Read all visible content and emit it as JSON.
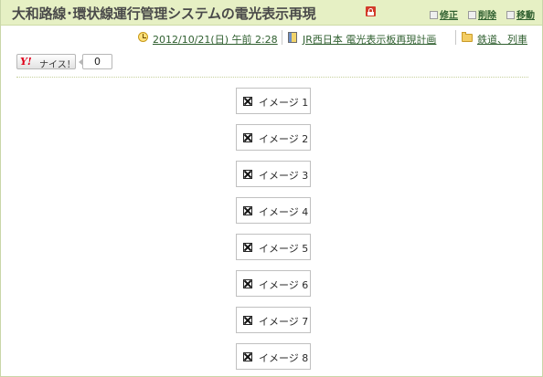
{
  "title": "大和路線･環状線運行管理システムの電光表示再現",
  "actions": {
    "edit": "修正",
    "delete": "削除",
    "move": "移動"
  },
  "meta": {
    "datetime": "2012/10/21(日) 午前 2:28",
    "theme": "JR西日本 電光表示板再現計画",
    "category": "鉄道、列車"
  },
  "nice": {
    "logo": "Y!",
    "label": "ナイス！",
    "count": "0"
  },
  "images": [
    {
      "alt": "イメージ 1"
    },
    {
      "alt": "イメージ 2"
    },
    {
      "alt": "イメージ 3"
    },
    {
      "alt": "イメージ 4"
    },
    {
      "alt": "イメージ 5"
    },
    {
      "alt": "イメージ 6"
    },
    {
      "alt": "イメージ 7"
    },
    {
      "alt": "イメージ 8"
    }
  ],
  "colors": {
    "title_bar_bg": "#e6f0c4",
    "link_green": "#2f5f2f",
    "lock_red": "#d23b2a"
  }
}
